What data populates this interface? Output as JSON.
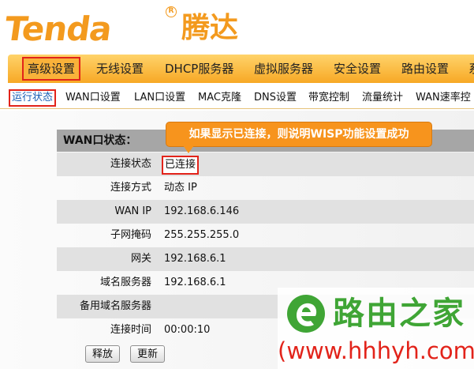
{
  "brand": {
    "logo_text": "Tenda",
    "logo_mark": "R",
    "logo_cn": "腾达"
  },
  "main_nav": [
    {
      "label": "高级设置",
      "active": true
    },
    {
      "label": "无线设置"
    },
    {
      "label": "DHCP服务器"
    },
    {
      "label": "虚拟服务器"
    },
    {
      "label": "安全设置"
    },
    {
      "label": "路由设置"
    },
    {
      "label": "系"
    }
  ],
  "sub_nav": [
    {
      "label": "运行状态",
      "active": true
    },
    {
      "label": "WAN口设置"
    },
    {
      "label": "LAN口设置"
    },
    {
      "label": "MAC克隆"
    },
    {
      "label": "DNS设置"
    },
    {
      "label": "带宽控制"
    },
    {
      "label": "流量统计"
    },
    {
      "label": "WAN速率控"
    }
  ],
  "wan_status": {
    "title": "WAN口状态：",
    "rows": [
      {
        "label": "连接状态",
        "value": "已连接"
      },
      {
        "label": "连接方式",
        "value": "动态 IP"
      },
      {
        "label": "WAN IP",
        "value": "192.168.6.146"
      },
      {
        "label": "子网掩码",
        "value": "255.255.255.0"
      },
      {
        "label": "网关",
        "value": "192.168.6.1"
      },
      {
        "label": "域名服务器",
        "value": "192.168.6.1"
      },
      {
        "label": "备用域名服务器",
        "value": ""
      },
      {
        "label": "连接时间",
        "value": "00:00:10"
      }
    ]
  },
  "buttons": {
    "release": "释放",
    "renew": "更新"
  },
  "callout": "如果显示已连接，则说明WISP功能设置成功",
  "watermark": {
    "cn": "路由之家",
    "url": "(www.hhhyh.com)"
  },
  "colors": {
    "brand_orange": "#f39a1e",
    "highlight_red": "#e2231a",
    "callout_orange": "#f7941d",
    "watermark_green": "#3fa535"
  }
}
